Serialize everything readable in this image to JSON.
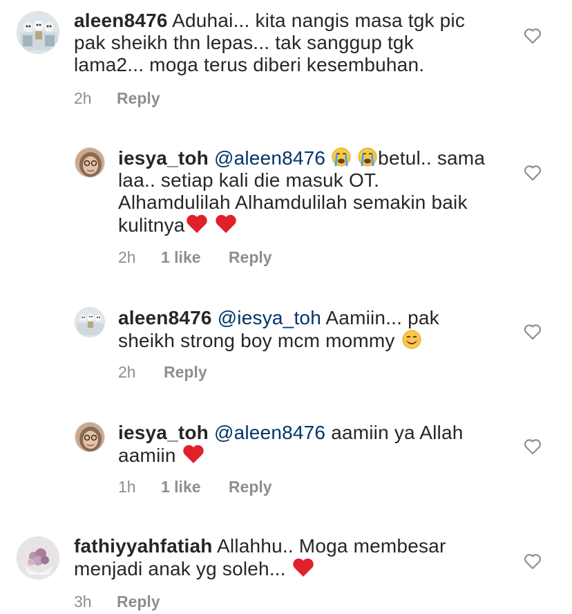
{
  "colors": {
    "text": "#262626",
    "secondary": "#8e8e8e",
    "mention": "#003569",
    "heart_red": "#e0202a"
  },
  "comments": [
    {
      "username": "aleen8476",
      "mention": "",
      "text_lines": [
        "Aduhai... kita nangis masa tgk pic",
        "pak sheikh thn lepas... tak sanggup tgk",
        "lama2... moga terus diberi kesembuhan."
      ],
      "time": "2h",
      "likes": "",
      "reply": "Reply",
      "like_icon": "heart-outline-icon"
    },
    {
      "username": "iesya_toh",
      "mention": "@aleen8476",
      "text_lines": [
        "betul.. sama",
        "laa.. setiap kali die masuk OT.",
        "Alhamdulilah Alhamdulilah semakin baik",
        "kulitnya"
      ],
      "time": "2h",
      "likes": "1 like",
      "reply": "Reply",
      "like_icon": "heart-outline-icon"
    },
    {
      "username": "aleen8476",
      "mention": "@iesya_toh",
      "text_lines": [
        "Aamiin... pak",
        "sheikh strong boy mcm mommy"
      ],
      "time": "2h",
      "likes": "",
      "reply": "Reply",
      "like_icon": "heart-outline-icon"
    },
    {
      "username": "iesya_toh",
      "mention": "@aleen8476",
      "text_lines": [
        "aamiin ya Allah",
        "aamiin"
      ],
      "time": "1h",
      "likes": "1 like",
      "reply": "Reply",
      "like_icon": "heart-outline-icon"
    },
    {
      "username": "fathiyyahfatiah",
      "mention": "",
      "text_lines": [
        "Allahhu.. Moga membesar",
        "menjadi anak yg soleh..."
      ],
      "time": "3h",
      "likes": "",
      "reply": "Reply",
      "like_icon": "heart-outline-icon"
    }
  ],
  "emojis": {
    "crying": "crying-face-emoji",
    "heart": "red-heart-emoji",
    "smile": "smiling-face-emoji"
  }
}
